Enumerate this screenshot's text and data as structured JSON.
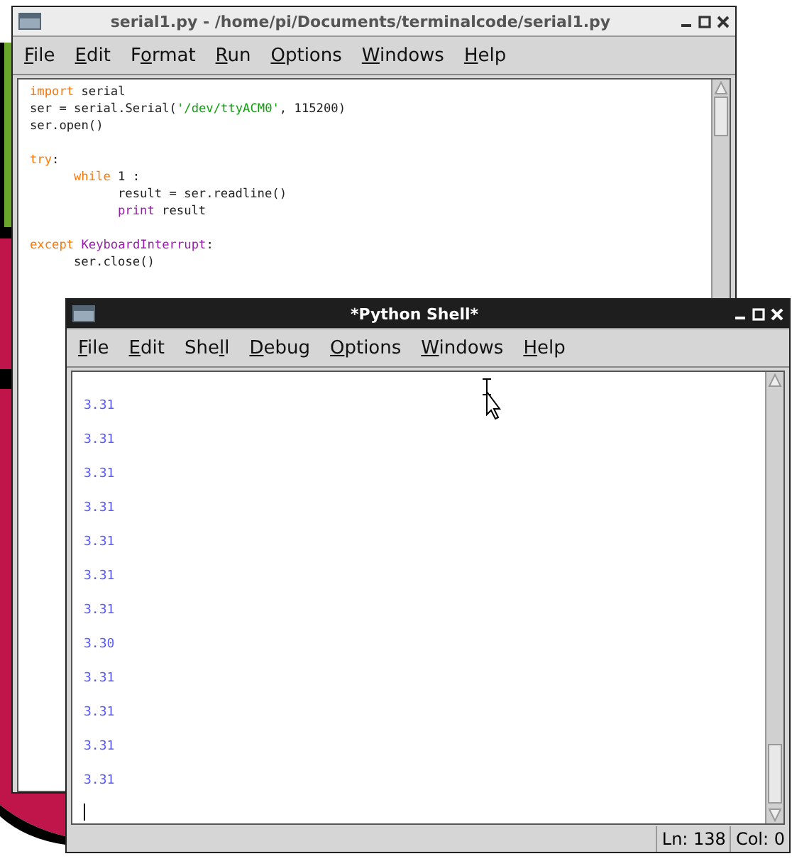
{
  "editor": {
    "title": "serial1.py - /home/pi/Documents/terminalcode/serial1.py",
    "menu": [
      {
        "key": "F",
        "post": "ile"
      },
      {
        "key": "E",
        "post": "dit"
      },
      {
        "pre": "F",
        "key": "o",
        "post": "rmat"
      },
      {
        "key": "R",
        "post": "un"
      },
      {
        "key": "O",
        "post": "ptions"
      },
      {
        "key": "W",
        "post": "indows"
      },
      {
        "key": "H",
        "post": "elp"
      }
    ],
    "code": [
      {
        "tokens": [
          {
            "text": "import",
            "kind": "keyword"
          },
          {
            "text": " serial",
            "kind": "plain"
          }
        ]
      },
      {
        "tokens": [
          {
            "text": "ser = serial.Serial(",
            "kind": "plain"
          },
          {
            "text": "'/dev/ttyACM0'",
            "kind": "string"
          },
          {
            "text": ", 115200)",
            "kind": "plain"
          }
        ]
      },
      {
        "tokens": [
          {
            "text": "ser.open()",
            "kind": "plain"
          }
        ]
      },
      {
        "blank_before": true,
        "tokens": [
          {
            "text": "try",
            "kind": "keyword"
          },
          {
            "text": ":",
            "kind": "plain"
          }
        ],
        "children": [
          {
            "tokens": [
              {
                "text": "while",
                "kind": "keyword"
              },
              {
                "text": " 1 :",
                "kind": "plain"
              }
            ],
            "children": [
              {
                "tokens": [
                  {
                    "text": "result = ser.readline()",
                    "kind": "plain"
                  }
                ]
              },
              {
                "tokens": [
                  {
                    "text": "print",
                    "kind": "builtin"
                  },
                  {
                    "text": " result",
                    "kind": "plain"
                  }
                ]
              }
            ]
          }
        ]
      },
      {
        "blank_before": true,
        "tokens": [
          {
            "text": "except",
            "kind": "keyword"
          },
          {
            "text": " KeyboardInterrupt",
            "kind": "builtin"
          },
          {
            "text": ":",
            "kind": "plain"
          }
        ],
        "children": [
          {
            "tokens": [
              {
                "text": "ser.close()",
                "kind": "plain"
              }
            ]
          }
        ]
      }
    ]
  },
  "shell": {
    "title": "*Python Shell*",
    "menu": [
      {
        "key": "F",
        "post": "ile"
      },
      {
        "key": "E",
        "post": "dit"
      },
      {
        "pre": "She",
        "key": "l",
        "post": "l"
      },
      {
        "key": "D",
        "post": "ebug"
      },
      {
        "key": "O",
        "post": "ptions"
      },
      {
        "key": "W",
        "post": "indows"
      },
      {
        "key": "H",
        "post": "elp"
      }
    ],
    "output": [
      "3.31",
      "3.31",
      "3.31",
      "3.31",
      "3.31",
      "3.31",
      "3.31",
      "3.30",
      "3.31",
      "3.31",
      "3.31",
      "3.31"
    ],
    "status_bar": {
      "line": "Ln: 138",
      "column": "Col: 0"
    }
  }
}
